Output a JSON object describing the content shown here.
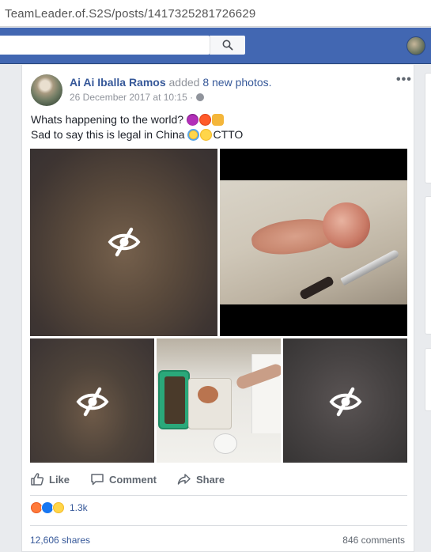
{
  "browser": {
    "url": "TeamLeader.of.S2S/posts/1417325281726629"
  },
  "post": {
    "author": "Ai Ai Iballa Ramos",
    "action_prefix": "added",
    "action_link": "8 new photos.",
    "timestamp": "26 December 2017 at 10:15 ·",
    "text_line1": "Whats happening to the world?",
    "text_line2": "Sad to say this is legal in China",
    "text_line2_suffix": "CTTO"
  },
  "actions": {
    "like": "Like",
    "comment": "Comment",
    "share": "Share"
  },
  "stats": {
    "reactions_count": "1.3k",
    "shares": "12,606 shares",
    "comments": "846 comments"
  },
  "colors": {
    "facebook_blue": "#4267b2",
    "link_blue": "#365899",
    "muted": "#90949c"
  }
}
